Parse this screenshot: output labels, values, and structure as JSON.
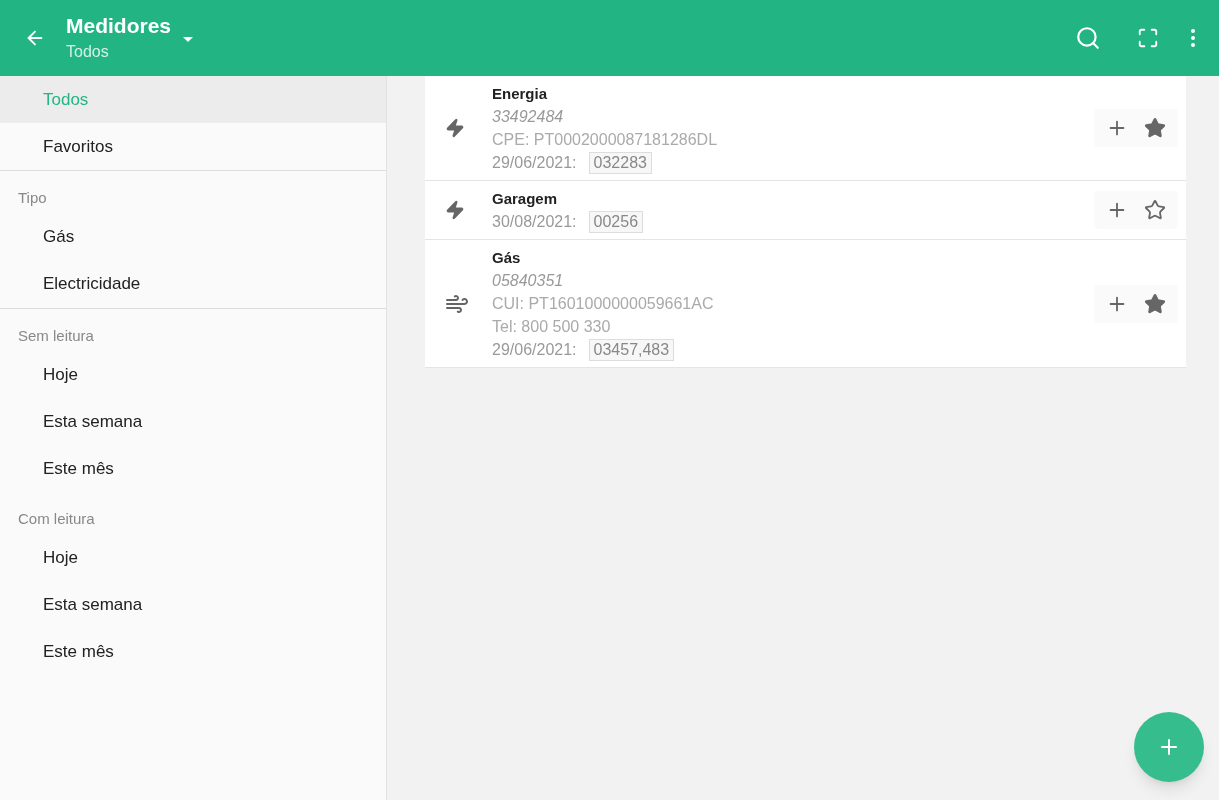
{
  "app_bar": {
    "title": "Medidores",
    "subtitle": "Todos"
  },
  "sidebar": {
    "groups": [
      {
        "items": [
          {
            "label": "Todos",
            "selected": true
          },
          {
            "label": "Favoritos",
            "selected": false
          }
        ]
      },
      {
        "heading": "Tipo",
        "items": [
          {
            "label": "Gás",
            "selected": false
          },
          {
            "label": "Electricidade",
            "selected": false
          }
        ]
      },
      {
        "heading": "Sem leitura",
        "items": [
          {
            "label": "Hoje",
            "selected": false
          },
          {
            "label": "Esta semana",
            "selected": false
          },
          {
            "label": "Este mês",
            "selected": false
          }
        ]
      },
      {
        "heading": "Com leitura",
        "items": [
          {
            "label": "Hoje",
            "selected": false
          },
          {
            "label": "Esta semana",
            "selected": false
          },
          {
            "label": "Este mês",
            "selected": false
          }
        ]
      }
    ]
  },
  "meters": [
    {
      "kind": "electric",
      "name": "Energia",
      "number": "33492484",
      "details": [
        "CPE: PT0002000087181286DL"
      ],
      "date": "29/06/2021:",
      "reading": "032283",
      "favorite": true
    },
    {
      "kind": "electric",
      "name": "Garagem",
      "date": "30/08/2021:",
      "reading": "00256",
      "favorite": false
    },
    {
      "kind": "gas",
      "name": "Gás",
      "number": "05840351",
      "details": [
        "CUI: PT1601000000059661AC",
        "Tel: 800 500 330"
      ],
      "date": "29/06/2021:",
      "reading": "03457,483",
      "favorite": true
    }
  ]
}
